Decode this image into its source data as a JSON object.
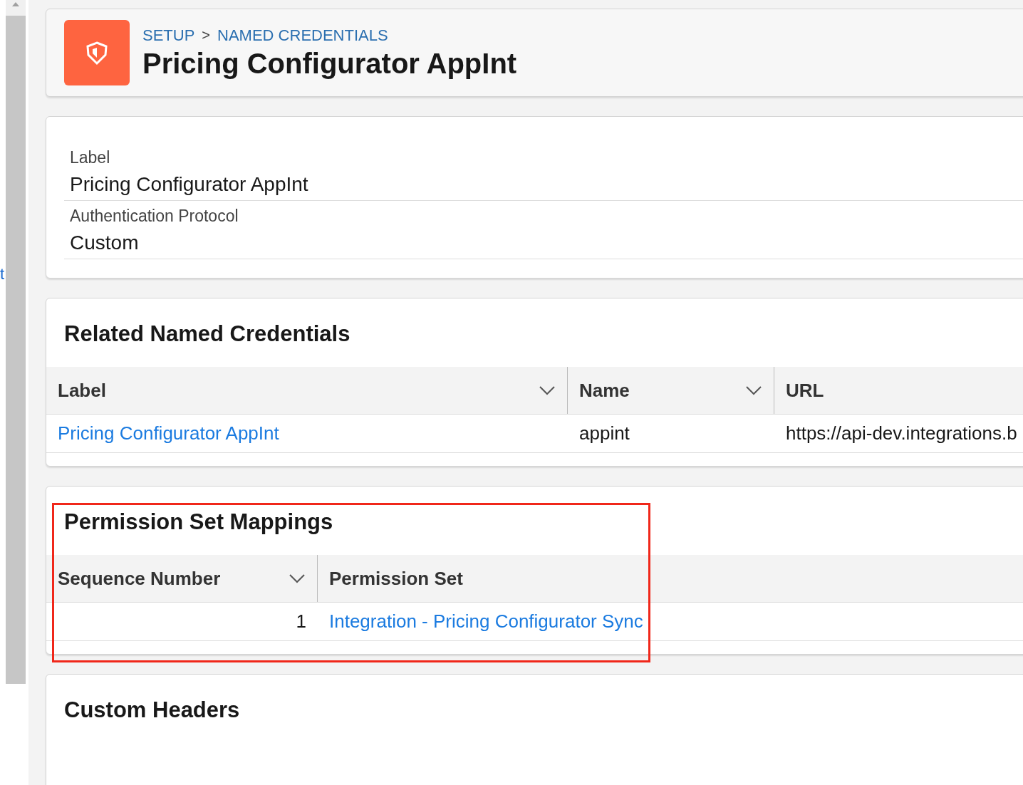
{
  "left_edge_text": "t",
  "header": {
    "breadcrumb": [
      {
        "label": "SETUP"
      },
      {
        "label": "NAMED CREDENTIALS"
      }
    ],
    "separator": ">",
    "title": "Pricing Configurator AppInt"
  },
  "details": [
    {
      "label": "Label",
      "value": "Pricing Configurator AppInt"
    },
    {
      "label": "Authentication Protocol",
      "value": "Custom"
    }
  ],
  "sections": [
    {
      "title": "Related Named Credentials",
      "highlighted": false,
      "table": {
        "columns": [
          {
            "label": "Label",
            "sortable": true
          },
          {
            "label": "Name",
            "sortable": true
          },
          {
            "label": "URL",
            "sortable": false
          }
        ],
        "rows": [
          [
            {
              "text": "Pricing Configurator AppInt",
              "kind": "link"
            },
            {
              "text": "appint",
              "kind": "text"
            },
            {
              "text": "https://api-dev.integrations.b",
              "kind": "text"
            }
          ]
        ]
      }
    },
    {
      "title": "Permission Set Mappings",
      "highlighted": true,
      "table": {
        "columns": [
          {
            "label": "Sequence Number",
            "sortable": true
          },
          {
            "label": "Permission Set",
            "sortable": false
          }
        ],
        "rows": [
          [
            {
              "text": "1",
              "kind": "number"
            },
            {
              "text": "Integration - Pricing Configurator Sync",
              "kind": "link"
            }
          ]
        ]
      }
    },
    {
      "title": "Custom Headers",
      "highlighted": false
    }
  ]
}
